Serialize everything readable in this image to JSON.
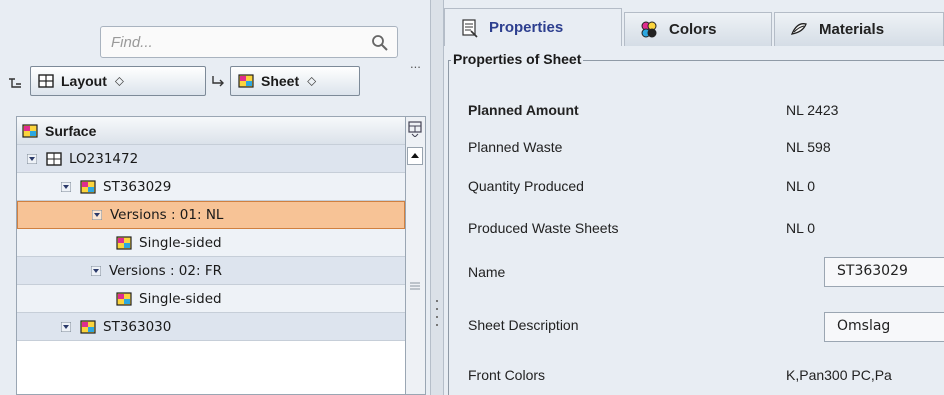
{
  "search": {
    "placeholder": "Find..."
  },
  "toolbar": {
    "more": "...",
    "layout_combo": "Layout",
    "sheet_combo": "Sheet",
    "spin_glyph": "⬦"
  },
  "tree": {
    "header": "Surface",
    "rows": [
      {
        "label": "LO231472",
        "level": 1,
        "icon": "layout-icon"
      },
      {
        "label": "ST363029",
        "level": 2,
        "icon": "sheet-icon"
      },
      {
        "label": "Versions : 01: NL",
        "level": 3,
        "icon": "",
        "selected": true
      },
      {
        "label": "Single-sided",
        "level": 4,
        "icon": "surface-icon"
      },
      {
        "label": "Versions : 02: FR",
        "level": 3,
        "icon": ""
      },
      {
        "label": "Single-sided",
        "level": 4,
        "icon": "surface-icon"
      },
      {
        "label": "ST363030",
        "level": 2,
        "icon": "sheet-icon"
      }
    ]
  },
  "tabs": [
    {
      "label": "Properties",
      "icon": "properties-icon",
      "active": true
    },
    {
      "label": "Colors",
      "icon": "colors-icon",
      "active": false
    },
    {
      "label": "Materials",
      "icon": "materials-icon",
      "active": false
    }
  ],
  "properties": {
    "group_title": "Properties of Sheet",
    "rows": [
      {
        "label": "Planned Amount",
        "value": "NL 2423",
        "bold": true
      },
      {
        "label": "Planned Waste",
        "value": "NL 598"
      },
      {
        "label": "Quantity Produced",
        "value": "NL 0"
      },
      {
        "label": "Produced Waste Sheets",
        "value": "NL 0"
      },
      {
        "label": "Name",
        "value": "ST363029",
        "editable": true
      },
      {
        "label": "Sheet Description",
        "value": "Omslag",
        "editable": true
      },
      {
        "label": "Front Colors",
        "value": "K,Pan300 PC,Pa"
      }
    ]
  },
  "colors": {
    "selected_row": "#f7c396",
    "active_tab_text": "#2d3f8f"
  }
}
